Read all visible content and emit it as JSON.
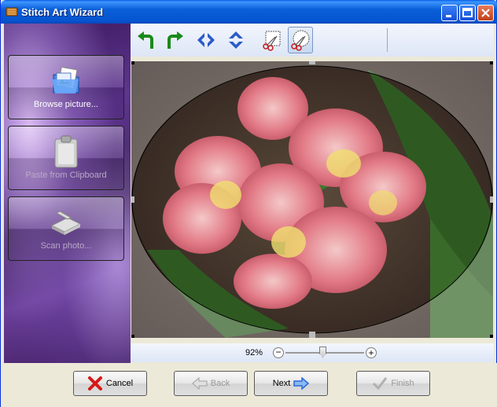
{
  "window": {
    "title": "Stitch Art Wizard"
  },
  "left_panel": {
    "buttons": [
      {
        "label": "Browse picture...",
        "icon": "folder-pictures-icon",
        "enabled": true
      },
      {
        "label": "Paste from Clipboard",
        "icon": "clipboard-icon",
        "enabled": false
      },
      {
        "label": "Scan photo...",
        "icon": "scanner-icon",
        "enabled": false
      }
    ]
  },
  "toolbar": {
    "tools": [
      {
        "name": "rotate-left",
        "icon": "rotate-left-icon"
      },
      {
        "name": "rotate-right",
        "icon": "rotate-right-icon"
      },
      {
        "name": "flip-horizontal",
        "icon": "flip-horizontal-icon"
      },
      {
        "name": "flip-vertical",
        "icon": "flip-vertical-icon"
      },
      {
        "name": "crop-rectangle",
        "icon": "crop-rectangle-icon"
      },
      {
        "name": "crop-ellipse",
        "icon": "crop-ellipse-icon",
        "active": true
      }
    ]
  },
  "zoom": {
    "label": "92%",
    "value_percent": 92,
    "minus": "−",
    "plus": "+"
  },
  "footer": {
    "cancel": "Cancel",
    "back": "Back",
    "next": "Next",
    "finish": "Finish"
  },
  "colors": {
    "titlebar": "#0554d0",
    "cancel_x": "#d81818",
    "next_arrow": "#2a6ad8"
  }
}
